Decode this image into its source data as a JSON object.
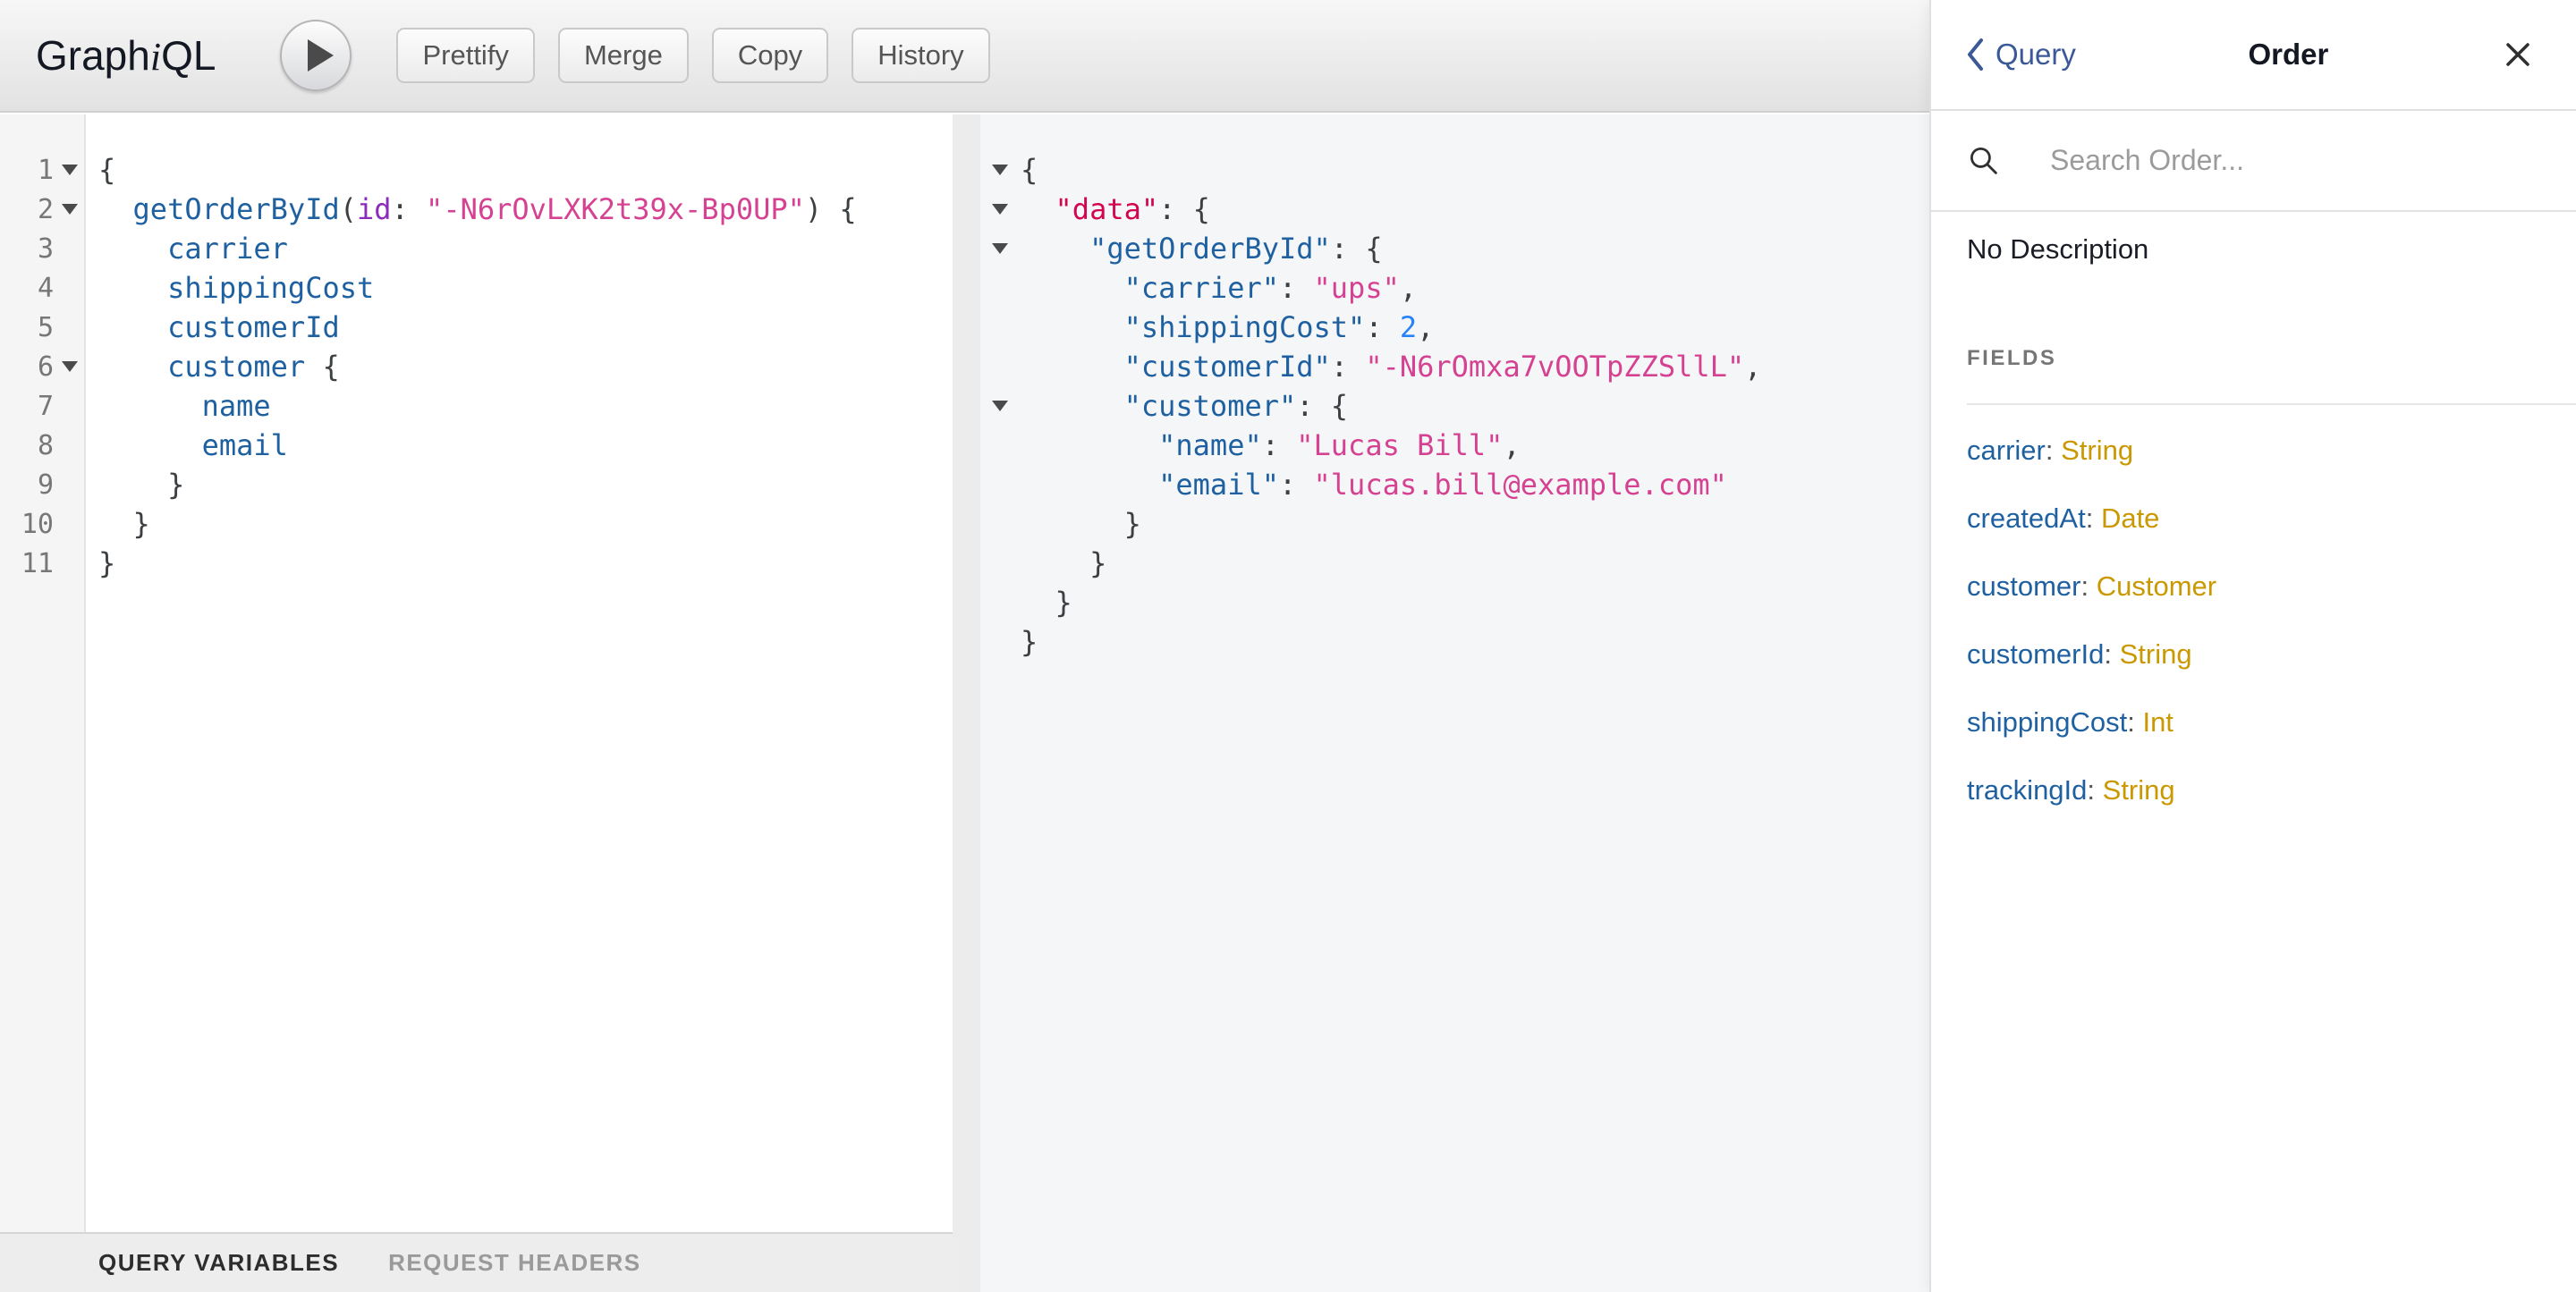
{
  "toolbar": {
    "logo_pre": "Graph",
    "logo_i": "i",
    "logo_post": "QL",
    "buttons": [
      "Prettify",
      "Merge",
      "Copy",
      "History"
    ]
  },
  "query_editor": {
    "lines": [
      {
        "num": "1",
        "fold": true,
        "tokens": [
          [
            "p",
            "{"
          ]
        ]
      },
      {
        "num": "2",
        "fold": true,
        "tokens": [
          [
            "p",
            "  "
          ],
          [
            "prop",
            "getOrderById"
          ],
          [
            "p",
            "("
          ],
          [
            "attr",
            "id"
          ],
          [
            "p",
            ": "
          ],
          [
            "str",
            "\"-N6rOvLXK2t39x-Bp0UP\""
          ],
          [
            "p",
            ") {"
          ]
        ]
      },
      {
        "num": "3",
        "fold": false,
        "tokens": [
          [
            "p",
            "    "
          ],
          [
            "prop",
            "carrier"
          ]
        ]
      },
      {
        "num": "4",
        "fold": false,
        "tokens": [
          [
            "p",
            "    "
          ],
          [
            "prop",
            "shippingCost"
          ]
        ]
      },
      {
        "num": "5",
        "fold": false,
        "tokens": [
          [
            "p",
            "    "
          ],
          [
            "prop",
            "customerId"
          ]
        ]
      },
      {
        "num": "6",
        "fold": true,
        "tokens": [
          [
            "p",
            "    "
          ],
          [
            "prop",
            "customer"
          ],
          [
            "p",
            " {"
          ]
        ]
      },
      {
        "num": "7",
        "fold": false,
        "tokens": [
          [
            "p",
            "      "
          ],
          [
            "prop",
            "name"
          ]
        ]
      },
      {
        "num": "8",
        "fold": false,
        "tokens": [
          [
            "p",
            "      "
          ],
          [
            "prop",
            "email"
          ]
        ]
      },
      {
        "num": "9",
        "fold": false,
        "tokens": [
          [
            "p",
            "    }"
          ]
        ]
      },
      {
        "num": "10",
        "fold": false,
        "tokens": [
          [
            "p",
            "  }"
          ]
        ]
      },
      {
        "num": "11",
        "fold": false,
        "tokens": [
          [
            "p",
            "}"
          ]
        ]
      }
    ]
  },
  "response_viewer": {
    "lines": [
      {
        "fold": true,
        "tokens": [
          [
            "p",
            "{"
          ]
        ]
      },
      {
        "fold": true,
        "tokens": [
          [
            "p",
            "  "
          ],
          [
            "kw",
            "\"data\""
          ],
          [
            "p",
            ": {"
          ]
        ]
      },
      {
        "fold": true,
        "tokens": [
          [
            "p",
            "    "
          ],
          [
            "prop",
            "\"getOrderById\""
          ],
          [
            "p",
            ": {"
          ]
        ]
      },
      {
        "fold": false,
        "tokens": [
          [
            "p",
            "      "
          ],
          [
            "prop",
            "\"carrier\""
          ],
          [
            "p",
            ": "
          ],
          [
            "str",
            "\"ups\""
          ],
          [
            "p",
            ","
          ]
        ]
      },
      {
        "fold": false,
        "tokens": [
          [
            "p",
            "      "
          ],
          [
            "prop",
            "\"shippingCost\""
          ],
          [
            "p",
            ": "
          ],
          [
            "num",
            "2"
          ],
          [
            "p",
            ","
          ]
        ]
      },
      {
        "fold": false,
        "tokens": [
          [
            "p",
            "      "
          ],
          [
            "prop",
            "\"customerId\""
          ],
          [
            "p",
            ": "
          ],
          [
            "str",
            "\"-N6rOmxa7vOOTpZZSllL\""
          ],
          [
            "p",
            ","
          ]
        ]
      },
      {
        "fold": true,
        "tokens": [
          [
            "p",
            "      "
          ],
          [
            "prop",
            "\"customer\""
          ],
          [
            "p",
            ": {"
          ]
        ]
      },
      {
        "fold": false,
        "tokens": [
          [
            "p",
            "        "
          ],
          [
            "prop",
            "\"name\""
          ],
          [
            "p",
            ": "
          ],
          [
            "str",
            "\"Lucas Bill\""
          ],
          [
            "p",
            ","
          ]
        ]
      },
      {
        "fold": false,
        "tokens": [
          [
            "p",
            "        "
          ],
          [
            "prop",
            "\"email\""
          ],
          [
            "p",
            ": "
          ],
          [
            "str",
            "\"lucas.bill@example.com\""
          ]
        ]
      },
      {
        "fold": false,
        "tokens": [
          [
            "p",
            "      }"
          ]
        ]
      },
      {
        "fold": false,
        "tokens": [
          [
            "p",
            "    }"
          ]
        ]
      },
      {
        "fold": false,
        "tokens": [
          [
            "p",
            "  }"
          ]
        ]
      },
      {
        "fold": false,
        "tokens": [
          [
            "p",
            "}"
          ]
        ]
      }
    ]
  },
  "variables_bar": {
    "tabs": [
      {
        "label": "QUERY VARIABLES",
        "active": true
      },
      {
        "label": "REQUEST HEADERS",
        "active": false
      }
    ]
  },
  "doc_explorer": {
    "back_label": "Query",
    "title": "Order",
    "search_placeholder": "Search Order...",
    "description": "No Description",
    "fields_header": "FIELDS",
    "fields": [
      {
        "name": "carrier",
        "type": "String"
      },
      {
        "name": "createdAt",
        "type": "Date"
      },
      {
        "name": "customer",
        "type": "Customer"
      },
      {
        "name": "customerId",
        "type": "String"
      },
      {
        "name": "shippingCost",
        "type": "Int"
      },
      {
        "name": "trackingId",
        "type": "String"
      }
    ]
  },
  "colors": {
    "punct": "#3c4043",
    "property": "#1F61A0",
    "attribute": "#8B2BB9",
    "string": "#D64292",
    "keyword": "#D2054E",
    "number": "#2882F9",
    "field": "#1F61A0",
    "type": "#CA9800",
    "backlink": "#3B5998"
  }
}
